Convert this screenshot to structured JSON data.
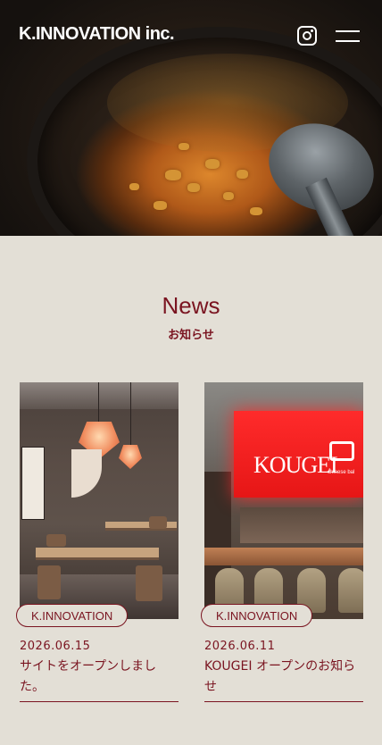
{
  "header": {
    "logo": "K.INNOVATION inc.",
    "instagram_icon": "instagram-icon",
    "menu_icon": "hamburger-menu-icon"
  },
  "news": {
    "title": "News",
    "subtitle": "お知らせ",
    "items": [
      {
        "category": "K.INNOVATION",
        "date": "2026.06.15",
        "title": "サイトをオープンしました。"
      },
      {
        "category": "K.INNOVATION",
        "date": "2026.06.11",
        "title": "KOUGEI オープンのお知らせ",
        "sign_text": "KOUGEI",
        "sign_sub": "chinese bal"
      }
    ]
  },
  "colors": {
    "accent": "#7a1420",
    "background": "#e3dfd6"
  }
}
